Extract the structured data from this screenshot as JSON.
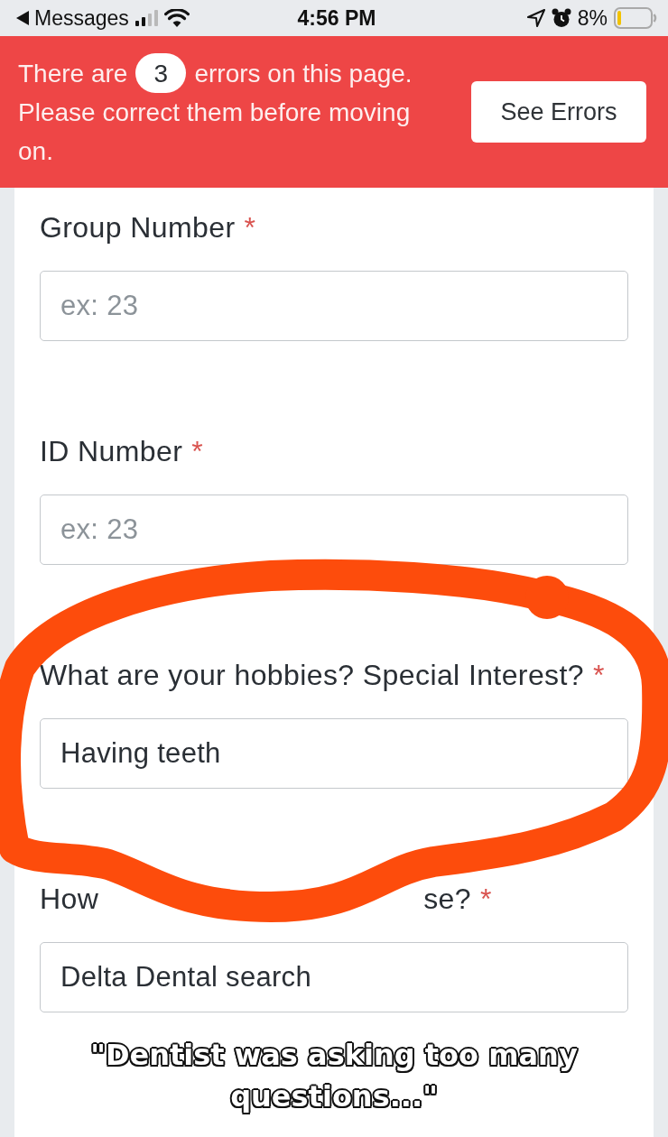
{
  "status_bar": {
    "back_label": "Messages",
    "time": "4:56 PM",
    "battery_percent": "8%"
  },
  "error_banner": {
    "lead": "There are",
    "count": "3",
    "trail": "errors on this page.",
    "message": "Please correct them before moving on.",
    "button": "See Errors"
  },
  "fields": [
    {
      "label": [
        "Group Number"
      ],
      "required_mark": "*",
      "placeholder": "ex: 23",
      "circled": false
    },
    {
      "label": [
        "ID Number"
      ],
      "required_mark": "*",
      "placeholder": "ex: 23",
      "circled": false
    },
    {
      "label": [
        "What are your hobbies? Special Interest?"
      ],
      "required_mark": "*",
      "value": "Having teeth",
      "circled": true
    },
    {
      "label": [
        "How",
        "se?"
      ],
      "required_mark": "*",
      "value": "Delta Dental search",
      "circled": false
    }
  ],
  "caption": "\"Dentist was asking too many questions...\""
}
